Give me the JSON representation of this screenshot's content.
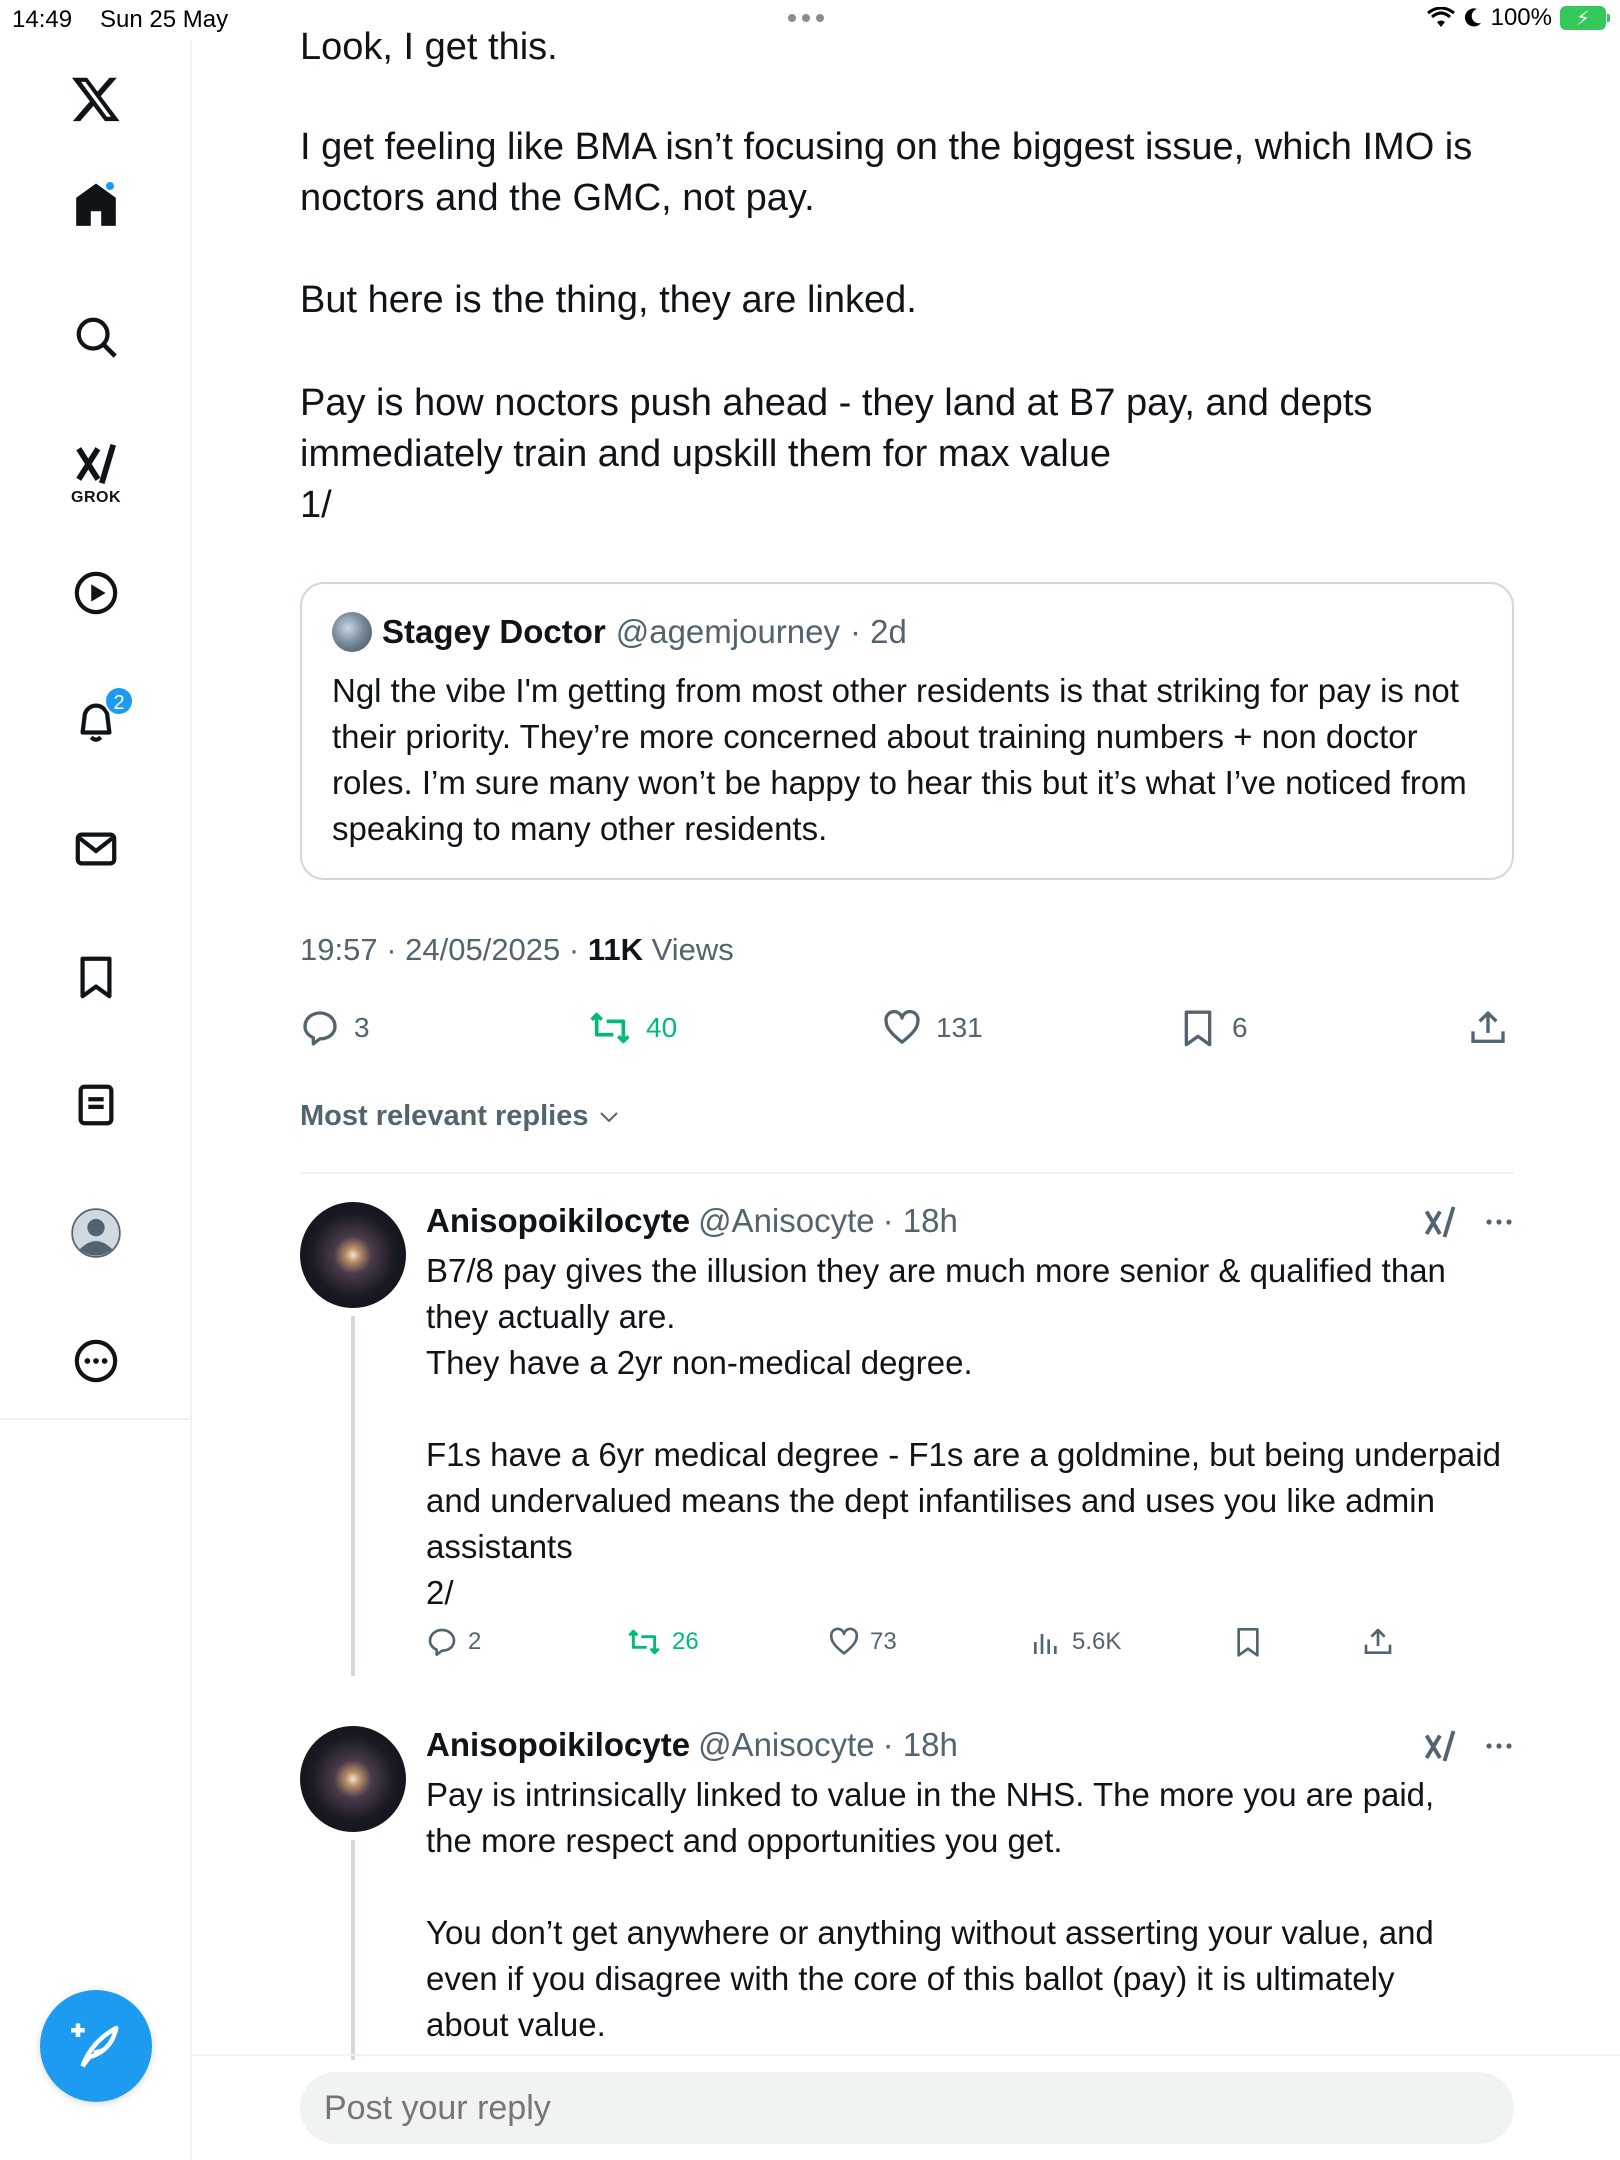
{
  "status_bar": {
    "time": "14:49",
    "date": "Sun 25 May",
    "battery": "100%"
  },
  "sidebar": {
    "grok_label": "GROK",
    "notifications_count": "2"
  },
  "post": {
    "paragraphs": [
      "Look, I get this.",
      "I get feeling like BMA isn’t focusing on the biggest issue, which IMO is\nnoctors and the GMC, not pay.",
      "But here is the thing, they are linked.",
      "Pay is how noctors push ahead - they land at B7 pay, and depts\nimmediately train and upskill them for max value\n1/"
    ],
    "quote": {
      "name": "Stagey Doctor",
      "handle": "@agemjourney",
      "time": "· 2d",
      "text": "Ngl the vibe I'm getting from most other residents is that striking for pay is not their priority. They’re more concerned about training numbers + non doctor roles. I’m sure many won’t be happy to hear this but it’s what I’ve noticed from speaking to many other residents."
    },
    "meta": {
      "timestamp": "19:57 · 24/05/2025 · ",
      "views_count": "11K",
      "views_label": " Views"
    },
    "actions": {
      "replies": "3",
      "reposts": "40",
      "likes": "131",
      "bookmarks": "6"
    }
  },
  "replies_header": "Most relevant replies",
  "replies": [
    {
      "name": "Anisopoikilocyte",
      "handle": "@Anisocyte",
      "time": "· 18h",
      "text": "B7/8 pay gives the illusion they are much more senior & qualified than\nthey actually are.\nThey have a 2yr non-medical degree.\n\nF1s have a 6yr medical degree - F1s are a goldmine, but being underpaid\nand undervalued means the dept infantilises and uses you like admin\nassistants\n2/",
      "replies": "2",
      "reposts": "26",
      "likes": "73",
      "views": "5.6K"
    },
    {
      "name": "Anisopoikilocyte",
      "handle": "@Anisocyte",
      "time": "· 18h",
      "text": "Pay is intrinsically linked to value in the NHS. The more you are paid,\nthe more respect and opportunities you get.\n\nYou don’t get anywhere or anything without asserting your value, and\neven if you disagree with the core of this ballot (pay) it is ultimately\nabout value."
    }
  ],
  "reply_box": {
    "placeholder": "Post your reply"
  },
  "colors": {
    "accent": "#1d9bf0",
    "repost_green": "#00ba7c",
    "secondary_text": "#536471"
  }
}
